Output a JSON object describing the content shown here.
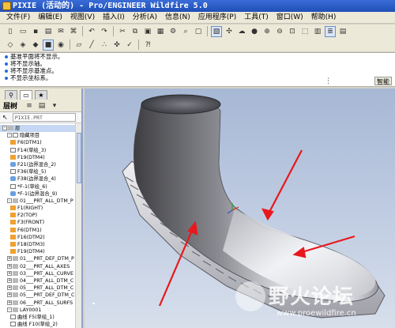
{
  "window": {
    "title": "PIXIE (活动的) - Pro/ENGINEER Wildfire 5.0"
  },
  "menu": [
    "文件(F)",
    "编辑(E)",
    "视图(V)",
    "插入(I)",
    "分析(A)",
    "信息(N)",
    "应用程序(P)",
    "工具(T)",
    "窗口(W)",
    "帮助(H)"
  ],
  "messages": [
    "基准平面将不显示。",
    "将不显示轴。",
    "将不显示基准点。",
    "不显示坐标系。"
  ],
  "smart_filter": "智能",
  "panel": {
    "label": "层树",
    "search_value": "PIXIE.PRT",
    "tree": [
      {
        "text": "层",
        "kind": "part",
        "exp": "-"
      },
      {
        "text": "隐藏项目",
        "kind": "feat",
        "exp": "-"
      },
      {
        "text": "F6(DTM1)",
        "kind": "datum"
      },
      {
        "text": "F14(草绘_3)",
        "kind": "feat"
      },
      {
        "text": "F19(DTM4)",
        "kind": "datum"
      },
      {
        "text": "F21(边界混合_2)",
        "kind": "surf"
      },
      {
        "text": "F36(草绘_5)",
        "kind": "feat"
      },
      {
        "text": "F38(边界混合_4)",
        "kind": "surf"
      },
      {
        "text": "*F-1(草绘_6)",
        "kind": "feat"
      },
      {
        "text": "*F-1(边界混合_9)",
        "kind": "surf"
      },
      {
        "text": "01___PRT_ALL_DTM_P",
        "kind": "part",
        "exp": "-"
      },
      {
        "text": "F1(RIGHT)",
        "kind": "datum"
      },
      {
        "text": "F2(TOP)",
        "kind": "datum"
      },
      {
        "text": "F3(FRONT)",
        "kind": "datum"
      },
      {
        "text": "F6(DTM1)",
        "kind": "datum"
      },
      {
        "text": "F16(DTM2)",
        "kind": "datum"
      },
      {
        "text": "F18(DTM3)",
        "kind": "datum"
      },
      {
        "text": "F19(DTM4)",
        "kind": "datum"
      },
      {
        "text": "01___PRT_DEF_DTM_P",
        "kind": "part",
        "exp": "+"
      },
      {
        "text": "02___PRT_ALL_AXES",
        "kind": "part",
        "exp": "+"
      },
      {
        "text": "03___PRT_ALL_CURVE",
        "kind": "part",
        "exp": "+"
      },
      {
        "text": "04___PRT_ALL_DTM_C",
        "kind": "part",
        "exp": "+"
      },
      {
        "text": "05___PRT_ALL_DTM_C",
        "kind": "part",
        "exp": "+"
      },
      {
        "text": "05___PRT_DEF_DTM_C",
        "kind": "part",
        "exp": "+"
      },
      {
        "text": "06___PRT_ALL_SURFS",
        "kind": "part",
        "exp": "+"
      },
      {
        "text": "LAY0001",
        "kind": "part",
        "exp": "-"
      },
      {
        "text": "曲线 F5(草绘_1)",
        "kind": "feat"
      },
      {
        "text": "曲线 F10(草绘_2)",
        "kind": "feat"
      }
    ]
  },
  "watermark": {
    "text": "野火论坛",
    "url": "www.proewildfire.cn"
  },
  "colors": {
    "arrow": "#e8181c",
    "viewport_top": "#a7b8d5",
    "viewport_bottom": "#d7dfeb"
  }
}
